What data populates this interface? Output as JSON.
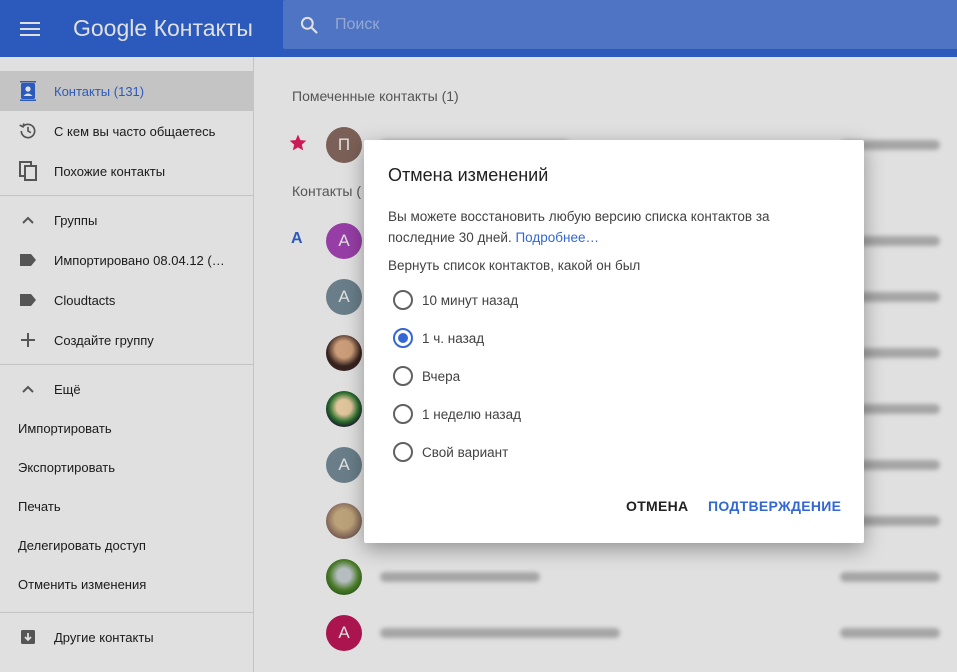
{
  "header": {
    "brand_google": "Google",
    "brand_product": "Контакты",
    "search_placeholder": "Поиск"
  },
  "sidebar": {
    "main_items": [
      {
        "label": "Контакты (131)",
        "icon": "contacts-icon"
      },
      {
        "label": "С кем вы часто общаетесь",
        "icon": "history-icon"
      },
      {
        "label": "Похожие контакты",
        "icon": "duplicates-icon"
      }
    ],
    "groups_header": "Группы",
    "groups": [
      {
        "label": "Импортировано 08.04.12 (…",
        "icon": "label-icon"
      },
      {
        "label": "Cloudtacts",
        "icon": "label-icon"
      },
      {
        "label": "Создайте группу",
        "icon": "plus-icon"
      }
    ],
    "more_header": "Ещё",
    "more_items": [
      "Импортировать",
      "Экспортировать",
      "Печать",
      "Делегировать доступ",
      "Отменить изменения"
    ],
    "other_contacts": "Другие контакты"
  },
  "main": {
    "starred_title": "Помеченные контакты (1)",
    "contacts_title": "Контакты (",
    "starred_avatar": "П",
    "section_letter": "A",
    "avatar_a": "A"
  },
  "dialog": {
    "title": "Отмена изменений",
    "body": "Вы можете восстановить любую версию списка контактов за последние 30 дней.",
    "link": "Подробнее…",
    "subtitle": "Вернуть список контактов, какой он был",
    "options": [
      "10 минут назад",
      "1 ч. назад",
      "Вчера",
      "1 неделю назад",
      "Свой вариант"
    ],
    "selected_index": 1,
    "cancel": "ОТМЕНА",
    "confirm": "ПОДТВЕРЖДЕНИЕ"
  },
  "colors": {
    "header": "#3367d6",
    "accent": "#3367d6",
    "star": "#e91e63"
  }
}
